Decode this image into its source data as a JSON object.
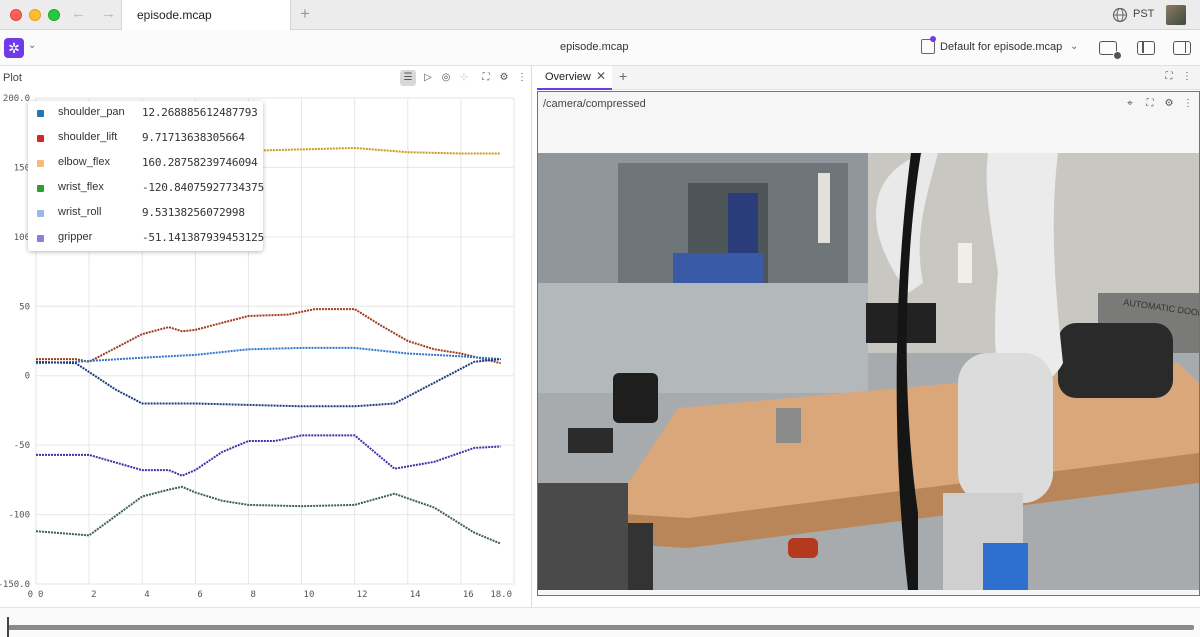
{
  "window": {
    "tab_title": "episode.mcap",
    "new_tab_glyph": "+",
    "back_glyph": "←",
    "forward_glyph": "→",
    "timezone": "PST",
    "icons": [
      "globe-icon",
      "user-avatar"
    ]
  },
  "toolbar": {
    "logo_glyph": "✲",
    "menu_chevron": "⌄",
    "doc_title": "episode.mcap",
    "layout_label": "Default for episode.mcap",
    "layout_chevron": "⌄",
    "icons": [
      "add-panel-icon",
      "left-sidebar-icon",
      "right-sidebar-icon"
    ]
  },
  "plot": {
    "title": "Plot",
    "icon_glyphs": {
      "legend": "☰",
      "cursor": "▷",
      "zoom": "◎",
      "pan": "⊹",
      "fullscreen": "⛶",
      "settings": "⚙",
      "more": "⋮"
    }
  },
  "legend": [
    {
      "name": "shoulder_pan",
      "value": "12.268885612487793",
      "color": "#1f77b4"
    },
    {
      "name": "shoulder_lift",
      "value": "9.71713638305664",
      "color": "#d62728"
    },
    {
      "name": "elbow_flex",
      "value": "160.28758239746094",
      "color": "#f5b97a"
    },
    {
      "name": "wrist_flex",
      "value": "-120.84075927734375",
      "color": "#2ca02c"
    },
    {
      "name": "wrist_roll",
      "value": "9.53138256072998",
      "color": "#9ab8e6"
    },
    {
      "name": "gripper",
      "value": "-51.141387939453125",
      "color": "#8a7fdc"
    }
  ],
  "chart_data": {
    "type": "line",
    "title": "",
    "xlabel": "",
    "ylabel": "",
    "xlim": [
      0,
      18
    ],
    "ylim": [
      -150,
      200
    ],
    "y_ticks": [
      "200.0",
      "150",
      "100",
      "50",
      "0",
      "-50",
      "-100",
      "-150.0"
    ],
    "x_ticks": [
      "0",
      "2",
      "4",
      "6",
      "8",
      "10",
      "12",
      "14",
      "16",
      "18.0"
    ],
    "grid": true,
    "series": [
      {
        "color": "#c79b1a",
        "x": [
          0,
          2,
          4,
          6,
          8,
          10,
          12,
          14,
          16,
          17.5
        ],
        "values": [
          165,
          163,
          161,
          161,
          162,
          163,
          164,
          161,
          160,
          160
        ]
      },
      {
        "color": "#a23a1e",
        "x": [
          0,
          1.5,
          2,
          3,
          4,
          5,
          5.5,
          6,
          7,
          8,
          9.5,
          10.5,
          12,
          13,
          14,
          15,
          16,
          17.5
        ],
        "values": [
          12,
          12,
          10,
          20,
          30,
          35,
          32,
          33,
          38,
          43,
          44,
          48,
          48,
          36,
          25,
          19,
          16,
          9
        ]
      },
      {
        "color": "#2f76c8",
        "x": [
          0,
          1.5,
          4,
          6,
          8,
          10,
          12,
          14,
          16,
          17.5
        ],
        "values": [
          9,
          10,
          13,
          15,
          19,
          20,
          20,
          16,
          14,
          12
        ]
      },
      {
        "color": "#1f3a7a",
        "x": [
          0,
          1.5,
          3,
          4,
          6,
          8,
          10,
          12,
          13.5,
          15,
          16.5,
          17.5
        ],
        "values": [
          10,
          9,
          -10,
          -20,
          -20,
          -21,
          -22,
          -22,
          -20,
          -5,
          10,
          12
        ]
      },
      {
        "color": "#3b34a6",
        "x": [
          0,
          2,
          4,
          5,
          5.5,
          6,
          7,
          8,
          9,
          10,
          12,
          13.5,
          15,
          16.5,
          17.5
        ],
        "values": [
          -57,
          -57,
          -68,
          -68,
          -72,
          -68,
          -55,
          -47,
          -47,
          -43,
          -43,
          -67,
          -62,
          -52,
          -51
        ]
      },
      {
        "color": "#3d6046",
        "x": [
          0,
          2,
          4,
          5,
          5.5,
          6,
          7,
          8,
          10,
          12,
          13.5,
          15,
          16.5,
          17.5
        ],
        "values": [
          -112,
          -115,
          -87,
          -82,
          -80,
          -84,
          -90,
          -93,
          -94,
          -93,
          -85,
          -95,
          -113,
          -121
        ]
      }
    ]
  },
  "overview": {
    "tab_label": "Overview",
    "close_glyph": "✕",
    "add_glyph": "+",
    "topic": "/camera/compressed",
    "icon_glyphs": {
      "expand": "⛶",
      "more": "⋮",
      "target": "⌖",
      "settings": "⚙"
    },
    "scene_text": "AUTOMATIC DOOR"
  }
}
